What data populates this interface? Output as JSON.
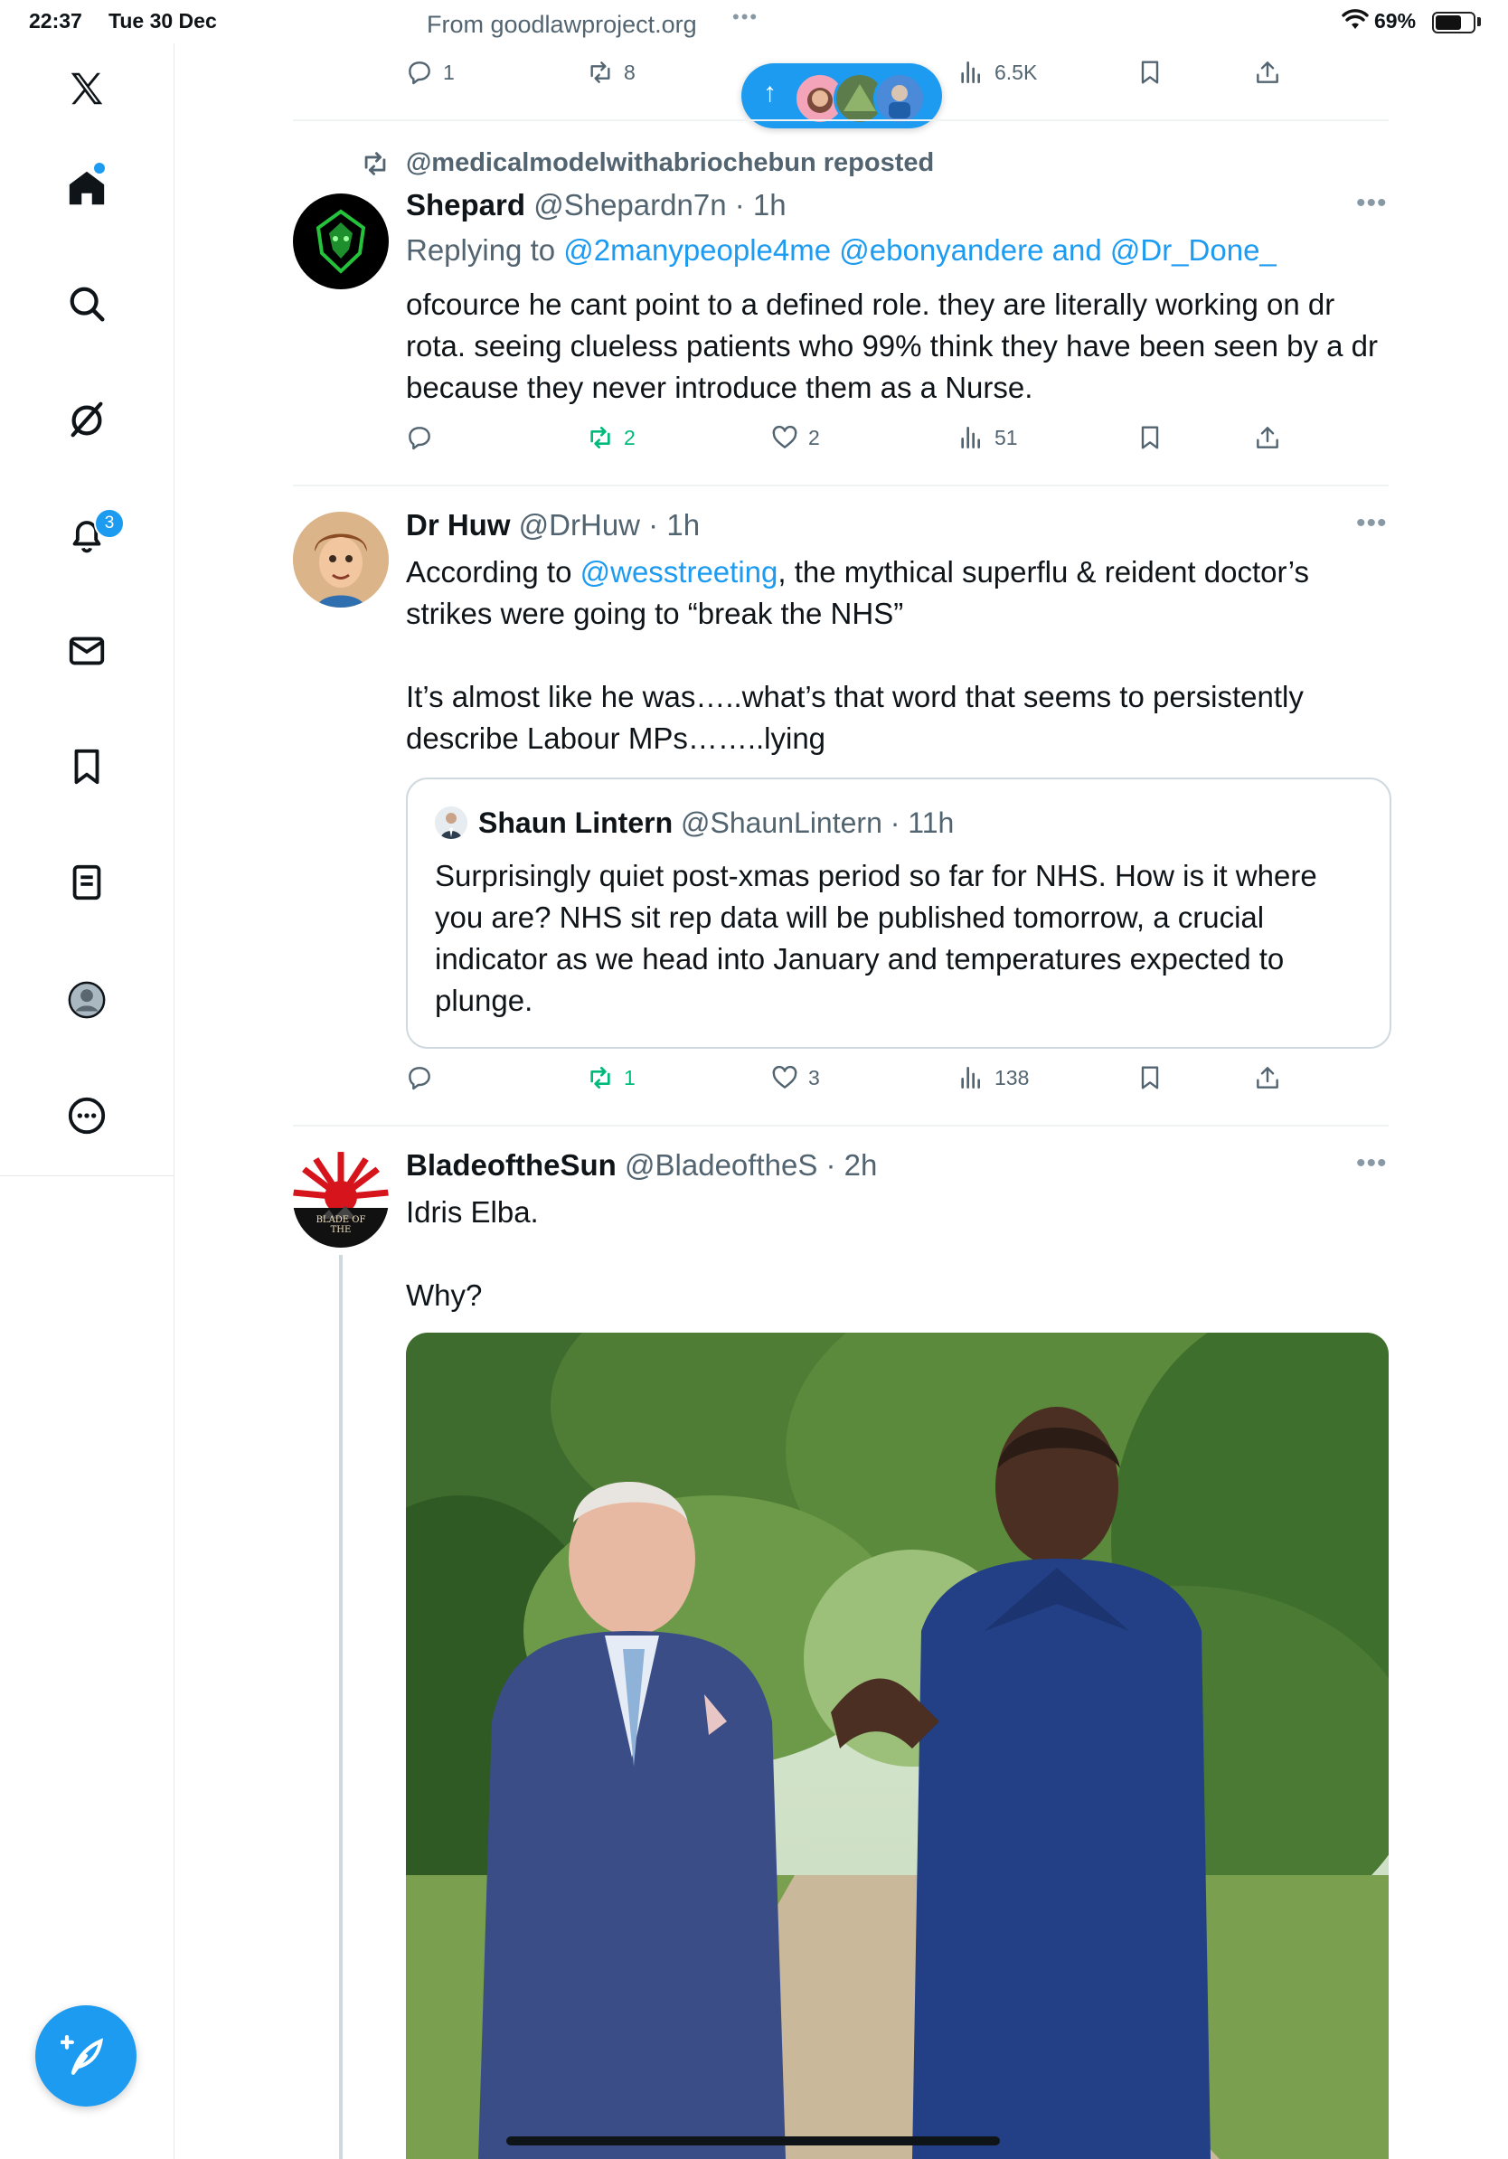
{
  "status_bar": {
    "time": "22:37",
    "date": "Tue 30 Dec",
    "source": "From goodlawproject.org",
    "more": "•••",
    "battery": "69%",
    "battery_level": 0.69
  },
  "sidebar": {
    "items": [
      {
        "icon": "x-logo-icon"
      },
      {
        "icon": "home-icon"
      },
      {
        "icon": "search-icon"
      },
      {
        "icon": "grok-icon"
      },
      {
        "icon": "notifications-icon",
        "badge": "3"
      },
      {
        "icon": "messages-icon"
      },
      {
        "icon": "bookmarks-icon"
      },
      {
        "icon": "lists-icon"
      },
      {
        "icon": "profile-icon"
      },
      {
        "icon": "more-icon"
      }
    ]
  },
  "top_actions": {
    "replies": "1",
    "reposts": "8",
    "views": "6.5K"
  },
  "posts": [
    {
      "repost_label": "@medicalmodelwithabriochebun reposted",
      "name": "Shepard",
      "meta": "@Shepardn7n · 1h",
      "replying_prefix": "Replying to ",
      "replying_to": "@2manypeople4me @ebonyandere",
      "replying_and": " and ",
      "replying_last": "@Dr_Done_",
      "text": "ofcource he cant point to a defined role. they are literally working on dr rota. seeing clueless patients who 99% think they have been seen by a dr because they never introduce them as a Nurse.",
      "reposts": "2",
      "likes": "2",
      "views": "51"
    },
    {
      "name": "Dr Huw",
      "meta": "@DrHuw · 1h",
      "text_prefix": "According to ",
      "text_mention": "@wesstreeting",
      "text_rest": ", the mythical superflu & reident doctor’s strikes were going to “break the NHS”\n\nIt’s almost like he was…..what’s that word that seems to persistently describe Labour MPs……..lying",
      "quote": {
        "name": "Shaun Lintern",
        "meta": "@ShaunLintern · 11h",
        "text": "Surprisingly quiet post-xmas period so far for NHS. How is it where you are? NHS sit rep data will be published tomorrow, a crucial indicator as we head into January and temperatures expected to plunge."
      },
      "reposts": "1",
      "likes": "3",
      "views": "138"
    },
    {
      "name": "BladeoftheSun",
      "meta": "@BladeoftheS · 2h",
      "text": "Idris Elba.\n\nWhy?",
      "avatar_text": "BLADE OF THE"
    }
  ],
  "colors": {
    "accent": "#1d9bf0",
    "repost_green": "#00ba7c",
    "muted": "#536471"
  }
}
